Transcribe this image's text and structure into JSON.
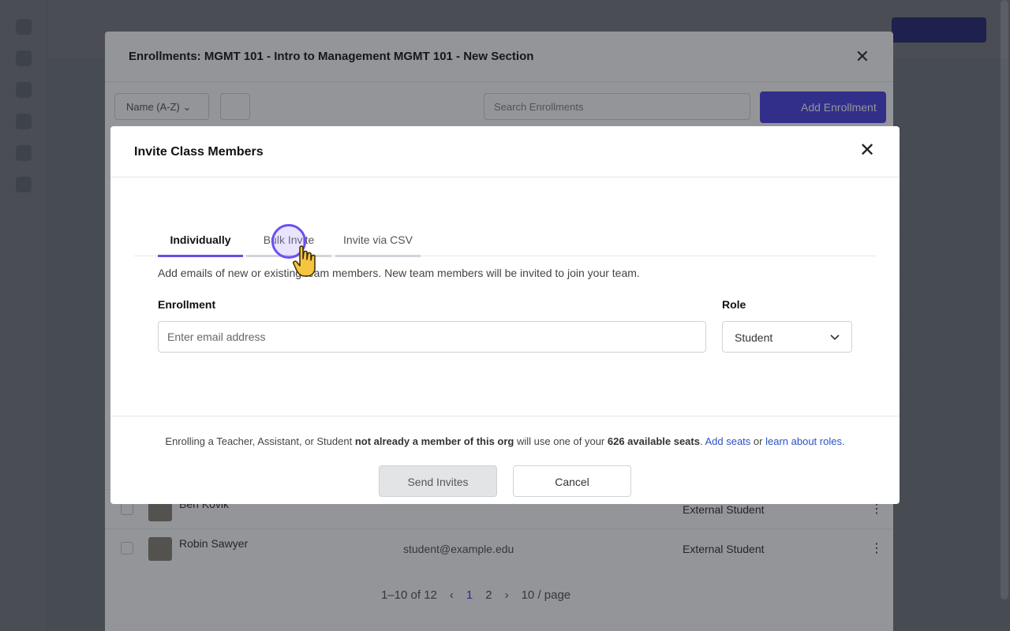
{
  "background": {
    "enrollments_title": "Enrollments: MGMT 101 - Intro to Management MGMT 101 - New Section",
    "sort_label": "Name (A-Z)",
    "search_placeholder": "Search Enrollments",
    "add_enrollment_label": "Add Enrollment",
    "rows": [
      {
        "name": "Ben Kovik",
        "email": "",
        "role": "External Student"
      },
      {
        "name": "Robin Sawyer",
        "email": "student@example.edu",
        "role": "External Student"
      }
    ],
    "pagination": {
      "range": "1–10 of 12",
      "pages": [
        "1",
        "2"
      ],
      "current": "1",
      "page_size": "10 / page"
    }
  },
  "modal": {
    "title": "Invite Class Members",
    "tabs": [
      {
        "label": "Individually",
        "active": true
      },
      {
        "label": "Bulk Invite",
        "active": false
      },
      {
        "label": "Invite via CSV",
        "active": false
      }
    ],
    "description": "Add emails of new or existing team members. New team members will be invited to join your team.",
    "enrollment_label": "Enrollment",
    "email_placeholder": "Enter email address",
    "email_value": "",
    "role_label": "Role",
    "role_value": "Student",
    "seat_note": {
      "part1": "Enrolling a Teacher, Assistant, or Student ",
      "bold1": "not already a member of this org",
      "part2": " will use one of your ",
      "bold2": "626 available seats",
      "part3": ". ",
      "link1": "Add seats",
      "part4": " or ",
      "link2": "learn about roles",
      "part5": "."
    },
    "send_label": "Send Invites",
    "cancel_label": "Cancel"
  },
  "colors": {
    "accent": "#6a4de0",
    "primary": "#4f46e5",
    "link": "#2b50c8"
  }
}
